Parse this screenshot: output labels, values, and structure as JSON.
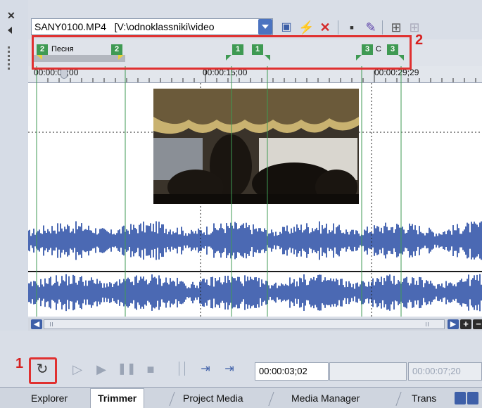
{
  "toolbar": {
    "filename": "SANY0100.MP4",
    "path": "[V:\\odnoklassniki\\video"
  },
  "markers": [
    {
      "id": "region2-start",
      "label": "2"
    },
    {
      "id": "region2-end",
      "label": "2"
    },
    {
      "id": "region1-start",
      "label": "1"
    },
    {
      "id": "region1-end",
      "label": "1"
    },
    {
      "id": "region3-start",
      "label": "3"
    },
    {
      "id": "region3-end",
      "label": "3"
    }
  ],
  "region_names": {
    "region2": "Песня",
    "region3": "C"
  },
  "ruler": {
    "labels": [
      "00:00:00;00",
      "00:00:15;00",
      "00:00:29;29"
    ]
  },
  "callouts": {
    "one": "1",
    "two": "2"
  },
  "transport": {
    "current_time": "00:00:03;02",
    "length_time": "",
    "end_time": "00:00:07;20"
  },
  "tabs": [
    "Explorer",
    "Trimmer",
    "Project Media",
    "Media Manager",
    "Trans"
  ],
  "active_tab": "Trimmer",
  "colors": {
    "marker_green": "#3f9a53",
    "highlight_red": "#e03030",
    "waveform_blue": "#4b69b3"
  }
}
